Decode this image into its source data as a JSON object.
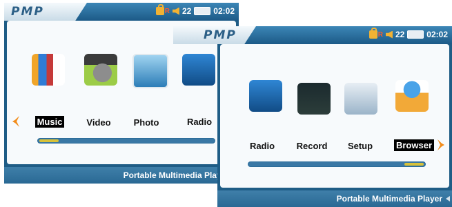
{
  "screens": [
    {
      "logo": "PMP",
      "status": {
        "volume": "22",
        "time": "02:02"
      },
      "menu": [
        {
          "label": "Music",
          "icon": "music-icon",
          "selected": true
        },
        {
          "label": "Video",
          "icon": "video-icon",
          "selected": false
        },
        {
          "label": "Photo",
          "icon": "photo-icon",
          "selected": false
        },
        {
          "label": "Radio",
          "icon": "radio-icon",
          "selected": false
        }
      ],
      "progress": 0.12,
      "tagline": "Portable Multimedia Player"
    },
    {
      "logo": "PMP",
      "status": {
        "volume": "22",
        "time": "02:02"
      },
      "menu": [
        {
          "label": "Radio",
          "icon": "radio-icon",
          "selected": false
        },
        {
          "label": "Record",
          "icon": "record-icon",
          "selected": false
        },
        {
          "label": "Setup",
          "icon": "setup-icon",
          "selected": false
        },
        {
          "label": "Browser",
          "icon": "browser-icon",
          "selected": true
        }
      ],
      "progress": 0.88,
      "tagline": "Portable Multimedia Player"
    }
  ],
  "colors": {
    "accent": "#1f5d86",
    "arrow": "#f28c1a",
    "progress_fill": "#d8c23a"
  }
}
